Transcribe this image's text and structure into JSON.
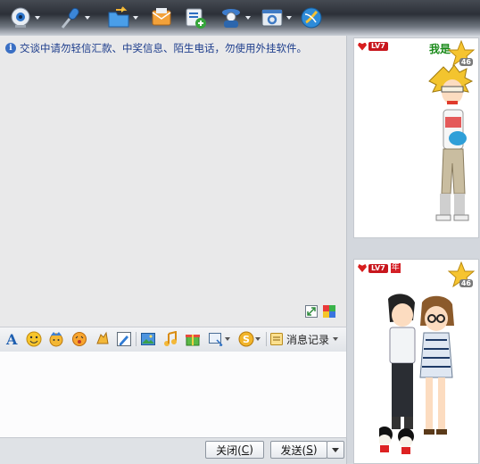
{
  "toolbar": {
    "buttons": [
      {
        "name": "video-call-button",
        "icon": "webcam-icon",
        "has_dropdown": true
      },
      {
        "name": "voice-call-button",
        "icon": "microphone-icon",
        "has_dropdown": true
      },
      {
        "name": "send-file-button",
        "icon": "folder-icon",
        "has_dropdown": true
      },
      {
        "name": "send-sms-button",
        "icon": "sms-icon",
        "has_dropdown": false
      },
      {
        "name": "create-group-button",
        "icon": "add-group-icon",
        "has_dropdown": false
      },
      {
        "name": "remote-assist-button",
        "icon": "user-info-icon",
        "has_dropdown": true
      },
      {
        "name": "app-settings-button",
        "icon": "settings-window-icon",
        "has_dropdown": true
      },
      {
        "name": "app-center-button",
        "icon": "app-globe-icon",
        "has_dropdown": false
      }
    ]
  },
  "notice": {
    "text": "交谈中请勿轻信汇款、中奖信息、陌生电话，勿使用外挂软件。"
  },
  "format_bar": {
    "message_log_label": "消息记录"
  },
  "buttons": {
    "close_label": "关闭(",
    "close_key": "C",
    "close_suffix": ")",
    "send_label": "发送(",
    "send_key": "S",
    "send_suffix": ")"
  },
  "friend_show": {
    "level_badge": "LV7",
    "vip_text": "我是",
    "star_level": "46"
  },
  "my_show": {
    "level_badge": "LV7",
    "year_badge": "年",
    "star_level": "46"
  },
  "colors": {
    "notice_text": "#1d3d8c",
    "toolbar_dark": "#2c3038",
    "badge_red": "#c8161d"
  }
}
